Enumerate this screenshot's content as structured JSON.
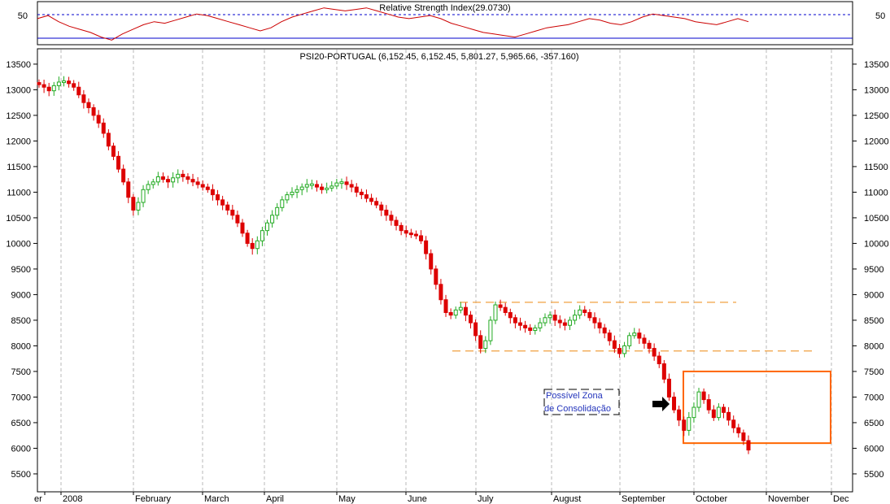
{
  "chart_data": [
    {
      "type": "line",
      "title": "Relative Strength Index(29.0730)",
      "y_tick_labels": [
        "50",
        "50"
      ],
      "reference_level": 50,
      "line_color": "#cc0000",
      "reference_color": "#0000cc",
      "values": [
        52,
        54,
        50,
        47,
        45,
        43,
        40,
        38,
        42,
        45,
        48,
        50,
        49,
        51,
        53,
        55,
        54,
        52,
        50,
        48,
        46,
        44,
        46,
        50,
        53,
        55,
        57,
        59,
        58,
        57,
        58,
        59,
        57,
        55,
        53,
        52,
        53,
        54,
        52,
        49,
        47,
        45,
        43,
        42,
        41,
        40,
        42,
        44,
        46,
        47,
        48,
        50,
        52,
        51,
        49,
        48,
        50,
        53,
        55,
        54,
        53,
        52,
        50,
        49,
        48,
        50,
        52,
        50
      ]
    },
    {
      "type": "candlestick",
      "title": "PSI20-PORTUGAL (6,152.45, 6,152.45, 5,801.27, 5,965.66, -357.160)",
      "y_ticks": [
        5500,
        6000,
        6500,
        7000,
        7500,
        8000,
        8500,
        9000,
        9500,
        10000,
        10500,
        11000,
        11500,
        12000,
        12500,
        13000,
        13500
      ],
      "ylim": [
        5150,
        13800
      ],
      "x_tick_labels": [
        "er",
        "2008",
        "February",
        "March",
        "April",
        "May",
        "June",
        "July",
        "August",
        "September",
        "October",
        "November",
        "Dec"
      ],
      "up_color": "#22aa22",
      "down_color": "#dd0000",
      "closes": [
        13100,
        13050,
        12980,
        13080,
        13150,
        13170,
        13120,
        13050,
        12900,
        12750,
        12650,
        12500,
        12350,
        12150,
        11900,
        11700,
        11450,
        11200,
        10900,
        10650,
        10800,
        11050,
        11150,
        11200,
        11300,
        11250,
        11200,
        11280,
        11350,
        11300,
        11250,
        11200,
        11150,
        11100,
        11050,
        10950,
        10850,
        10750,
        10650,
        10550,
        10400,
        10200,
        10000,
        9900,
        10050,
        10250,
        10400,
        10550,
        10700,
        10850,
        10950,
        11000,
        11050,
        11100,
        11150,
        11150,
        11100,
        11050,
        11080,
        11120,
        11180,
        11200,
        11150,
        11100,
        11000,
        10950,
        10880,
        10820,
        10750,
        10650,
        10550,
        10450,
        10350,
        10250,
        10200,
        10180,
        10150,
        10050,
        9800,
        9500,
        9200,
        8900,
        8650,
        8600,
        8700,
        8750,
        8600,
        8450,
        8200,
        7950,
        8100,
        8500,
        8800,
        8750,
        8650,
        8550,
        8450,
        8400,
        8350,
        8300,
        8350,
        8450,
        8550,
        8600,
        8500,
        8450,
        8400,
        8500,
        8600,
        8700,
        8650,
        8550,
        8450,
        8350,
        8250,
        8100,
        7950,
        7850,
        8000,
        8200,
        8250,
        8150,
        8050,
        7950,
        7800,
        7650,
        7350,
        7000,
        6750,
        6550,
        6350,
        6600,
        6800,
        7100,
        6950,
        6750,
        6600,
        6800,
        6700,
        6550,
        6400,
        6300,
        6150,
        5966
      ]
    }
  ],
  "annotations": {
    "note_line1": "Possível Zona",
    "note_line2": "de Consolidação",
    "arrow_icon": "right-arrow",
    "consolidation_top": 8850,
    "consolidation_bottom": 7900,
    "box_top": 7500,
    "box_bottom": 6100,
    "line_color": "#f0a040",
    "box_color": "#ff6600"
  }
}
